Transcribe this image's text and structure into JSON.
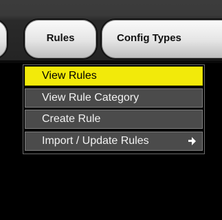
{
  "tabs": [
    {
      "label": ""
    },
    {
      "label": "Rules"
    },
    {
      "label": "Config Types"
    }
  ],
  "menu": {
    "items": [
      {
        "label": "View Rules",
        "selected": true
      },
      {
        "label": "View Rule Category"
      },
      {
        "label": "Create Rule"
      },
      {
        "label": "Import / Update Rules",
        "has_submenu": true,
        "submenu_icon": "submenu-arrow-icon"
      }
    ]
  },
  "colors": {
    "highlight": "#f2ea0a",
    "menu_item_bg": "#4b4b4b",
    "background": "#000000"
  }
}
